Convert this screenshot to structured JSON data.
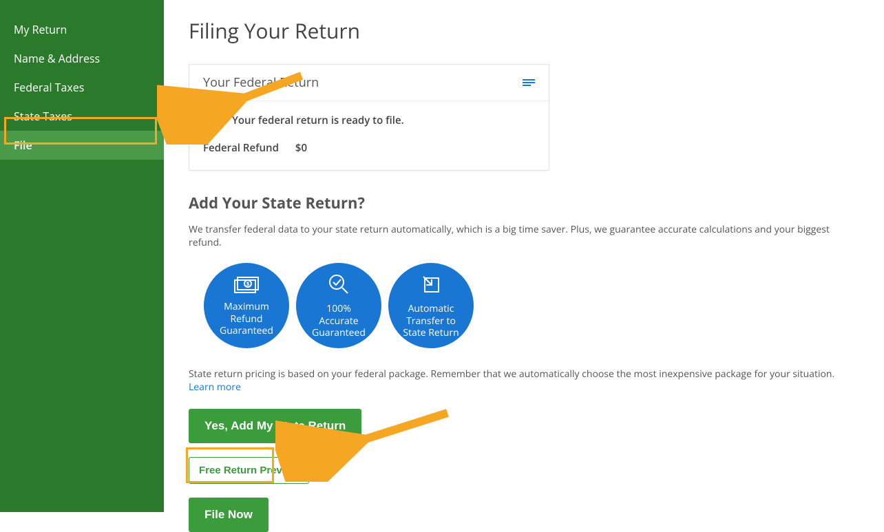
{
  "sidebar": {
    "items": [
      {
        "label": "My Return"
      },
      {
        "label": "Name & Address"
      },
      {
        "label": "Federal Taxes"
      },
      {
        "label": "State Taxes"
      },
      {
        "label": "File"
      }
    ]
  },
  "page": {
    "title": "Filing Your Return"
  },
  "federal_card": {
    "title": "Your Federal Return",
    "status": "Your federal return is ready to file.",
    "refund_label": "Federal Refund",
    "refund_value": "$0"
  },
  "state_section": {
    "title": "Add Your State Return?",
    "description": "We transfer federal data to your state return automatically, which is a big time saver. Plus, we guarantee accurate calculations and your biggest refund.",
    "badges": [
      {
        "line1": "Maximum",
        "line2": "Refund",
        "line3": "Guaranteed",
        "icon": "money-icon"
      },
      {
        "line1": "100%",
        "line2": "Accurate",
        "line3": "Guaranteed",
        "icon": "check-search-icon"
      },
      {
        "line1": "Automatic",
        "line2": "Transfer to",
        "line3": "State Return",
        "icon": "transfer-icon"
      }
    ],
    "pricing_text": "State return pricing is based on your federal package. Remember that we automatically choose the most inexpensive package for your situation. ",
    "learn_more": "Learn more"
  },
  "buttons": {
    "add_state": "Yes, Add My State Return",
    "preview": "Free Return Preview",
    "file_now": "File Now"
  },
  "annotations": {
    "arrow_to_sidebar": true,
    "arrow_to_filenow": true
  }
}
